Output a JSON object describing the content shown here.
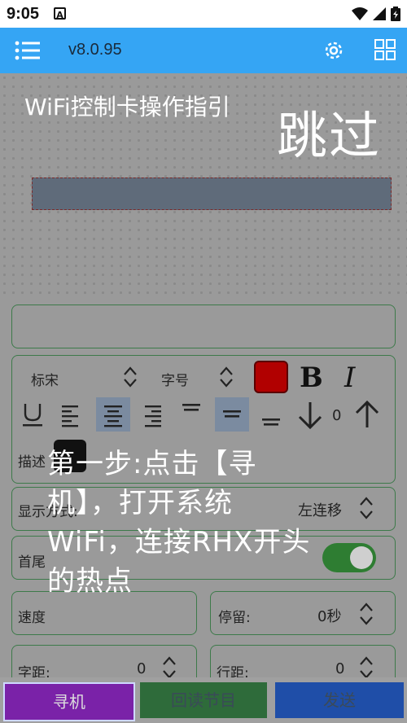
{
  "status_bar": {
    "time": "9:05",
    "notif_icon_letter": "A"
  },
  "app_bar": {
    "version": "v8.0.95"
  },
  "guide": {
    "title": "WiFi控制卡操作指引",
    "skip": "跳过",
    "step_text": "第一步:点击【寻机】，打开系统WiFi，连接RHX开头的热点"
  },
  "font_row": {
    "font_name": "标宋",
    "size_label": "字号"
  },
  "align_row": {
    "spacing_value": "0"
  },
  "form": {
    "describe_label": "描述",
    "display_mode_label": "显示方式:",
    "display_mode_value": "左连移",
    "head_tail_label": "首尾",
    "speed_label": "速度",
    "stay_label": "停留:",
    "stay_value": "0秒",
    "char_spacing_label": "字距:",
    "char_spacing_value": "0",
    "line_spacing_label": "行距:",
    "line_spacing_value": "0"
  },
  "bottom": {
    "search": "寻机",
    "readback": "回读节目",
    "send": "发送"
  },
  "colors": {
    "app_bar": "#35a5f4",
    "text_color": "#b10000",
    "toggle_on": "#2e7d32"
  }
}
